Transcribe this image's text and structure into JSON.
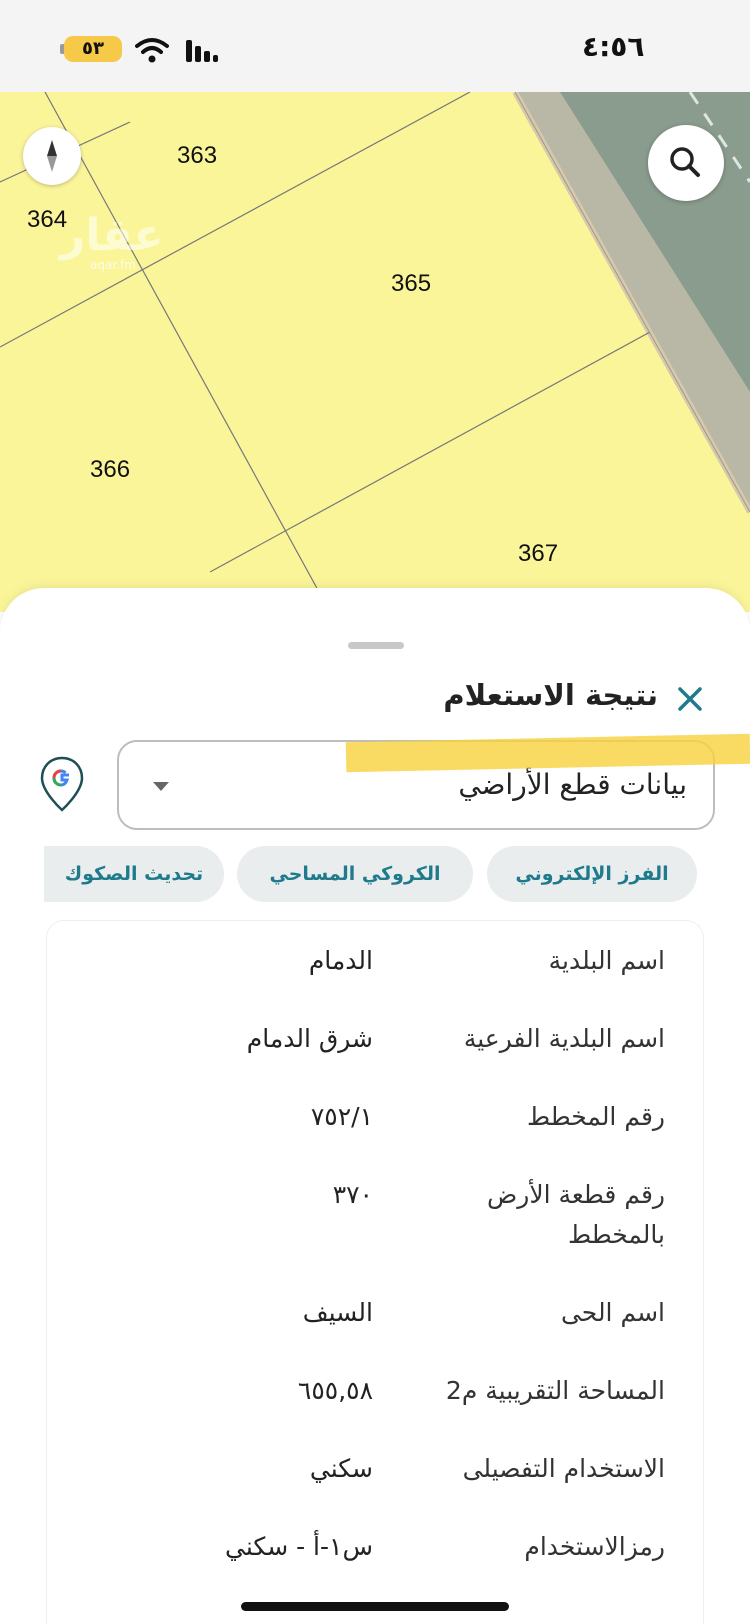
{
  "status_bar": {
    "time": "٤:٥٦",
    "battery": "٥٣",
    "battery_color": "#f7c948"
  },
  "map": {
    "background_color": "#fbf59a",
    "parcels": [
      "363",
      "364",
      "365",
      "366",
      "367"
    ],
    "compass_icon": "compass-icon",
    "search_icon": "search-icon"
  },
  "sheet": {
    "title": "نتيجة الاستعلام",
    "close_icon": "close-icon",
    "dropdown_value": "بيانات قطع الأراضي",
    "google_icon": "google-pin-icon",
    "chips": [
      "الفرز الإلكتروني",
      "الكروكي المساحي",
      "تحديث الصكوك"
    ],
    "accent_color": "#1f7a8c",
    "details": [
      {
        "label": "اسم البلدية",
        "value": "الدمام"
      },
      {
        "label": "اسم البلدية الفرعية",
        "value": "شرق الدمام"
      },
      {
        "label": "رقم المخطط",
        "value": "٧٥٢/١"
      },
      {
        "label": "رقم قطعة الأرض بالمخطط",
        "value": "٣٧٠"
      },
      {
        "label": "اسم الحى",
        "value": "السيف"
      },
      {
        "label": "المساحة التقريبية م2",
        "value": "٦٥٥,٥٨"
      },
      {
        "label": "الاستخدام التفصيلى",
        "value": "سكني"
      },
      {
        "label": "رمزالاستخدام",
        "value": "س١-أ - سكني"
      }
    ]
  }
}
